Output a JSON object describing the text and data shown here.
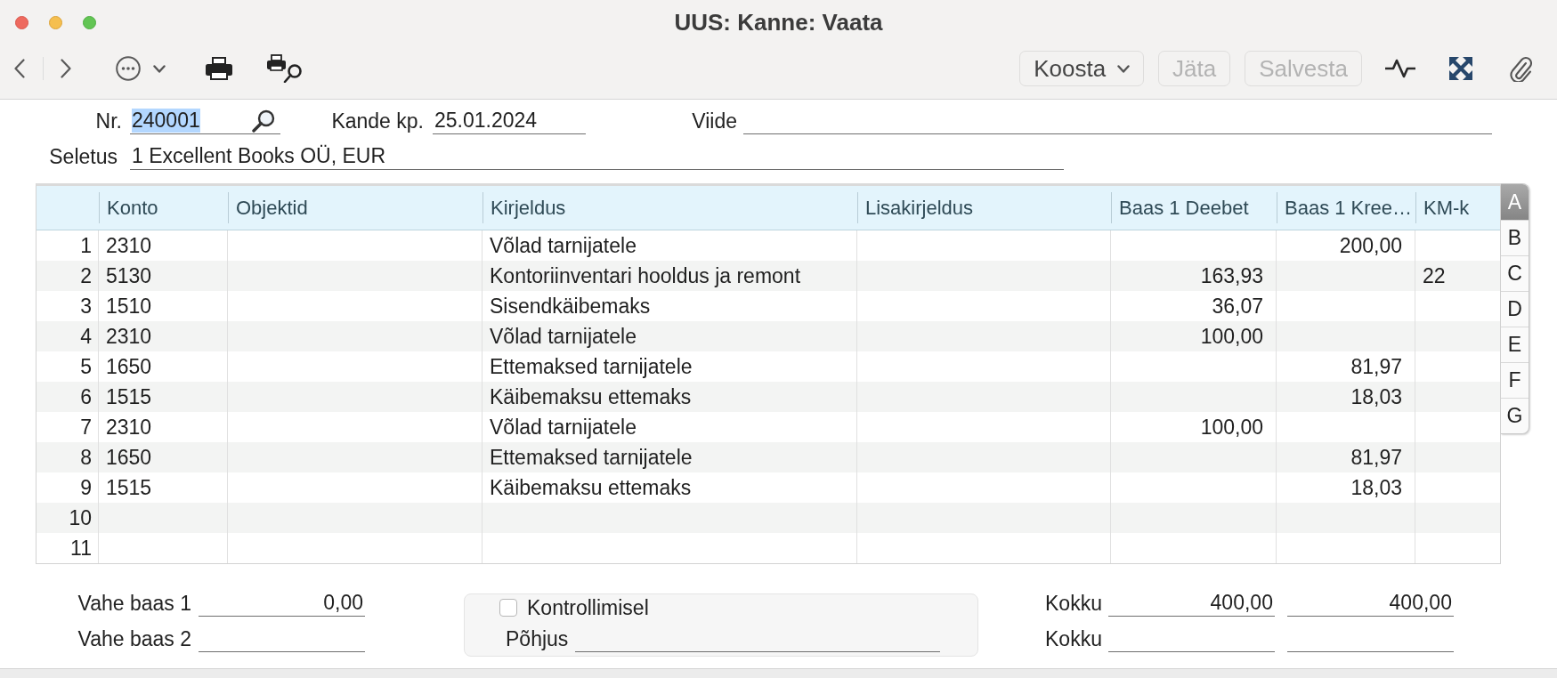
{
  "window": {
    "title": "UUS: Kanne: Vaata"
  },
  "toolbar": {
    "buttons": [
      {
        "label": "Koosta",
        "kind": "menu",
        "disabled": false
      },
      {
        "label": "Jäta",
        "kind": "plain",
        "disabled": true
      },
      {
        "label": "Salvesta",
        "kind": "plain",
        "disabled": true
      }
    ]
  },
  "header": {
    "fields": [
      {
        "label": "Nr.",
        "value": "240001",
        "kind": "lookup",
        "highlighted": true
      },
      {
        "label": "Kande kp.",
        "value": "25.01.2024",
        "kind": "text",
        "highlighted": false
      },
      {
        "label": "Viide",
        "kind": "text"
      },
      {
        "label": "Seletus",
        "value": "1 Excellent Books OÜ, EUR",
        "kind": "text",
        "highlighted": false
      }
    ]
  },
  "table": {
    "columns": [
      {
        "label": "Konto",
        "kind": "text"
      },
      {
        "label": "Objektid",
        "kind": "text"
      },
      {
        "label": "Kirjeldus",
        "kind": "text"
      },
      {
        "label": "Lisakirjeldus",
        "kind": "text"
      },
      {
        "label": "Baas 1 Deebet",
        "kind": "amount"
      },
      {
        "label": "Baas 1 Kree…",
        "kind": "amount"
      },
      {
        "label": "KM-k",
        "kind": "text"
      }
    ],
    "rows": [
      {
        "number": "1",
        "cells": [
          "2310",
          null,
          "Võlad tarnijatele",
          null,
          null,
          "200,00",
          null
        ]
      },
      {
        "number": "2",
        "cells": [
          "5130",
          null,
          "Kontoriinventari hooldus ja remont",
          null,
          "163,93",
          null,
          "22"
        ]
      },
      {
        "number": "3",
        "cells": [
          "1510",
          null,
          "Sisendkäibemaks",
          null,
          "36,07",
          null,
          null
        ]
      },
      {
        "number": "4",
        "cells": [
          "2310",
          null,
          "Võlad tarnijatele",
          null,
          "100,00",
          null,
          null
        ]
      },
      {
        "number": "5",
        "cells": [
          "1650",
          null,
          "Ettemaksed tarnijatele",
          null,
          null,
          "81,97",
          null
        ]
      },
      {
        "number": "6",
        "cells": [
          "1515",
          null,
          "Käibemaksu ettemaks",
          null,
          null,
          "18,03",
          null
        ]
      },
      {
        "number": "7",
        "cells": [
          "2310",
          null,
          "Võlad tarnijatele",
          null,
          "100,00",
          null,
          null
        ]
      },
      {
        "number": "8",
        "cells": [
          "1650",
          null,
          "Ettemaksed tarnijatele",
          null,
          null,
          "81,97",
          null
        ]
      },
      {
        "number": "9",
        "cells": [
          "1515",
          null,
          "Käibemaksu ettemaks",
          null,
          null,
          "18,03",
          null
        ]
      },
      {
        "number": "10",
        "cells": [
          null,
          null,
          null,
          null,
          null,
          null,
          null
        ]
      },
      {
        "number": "11",
        "cells": [
          null,
          null,
          null,
          null,
          null,
          null,
          null
        ]
      }
    ]
  },
  "letter_tabs": [
    {
      "label": "A",
      "selected": true
    },
    {
      "label": "B",
      "selected": false
    },
    {
      "label": "C",
      "selected": false
    },
    {
      "label": "D",
      "selected": false
    },
    {
      "label": "E",
      "selected": false
    },
    {
      "label": "F",
      "selected": false
    },
    {
      "label": "G",
      "selected": false
    }
  ],
  "footer": {
    "differences": [
      {
        "label": "Vahe baas 1",
        "value": "0,00"
      },
      {
        "label": "Vahe baas 2"
      }
    ],
    "review": {
      "checkbox": {
        "label": "Kontrollimisel",
        "checked": false
      },
      "reason": {
        "label": "Põhjus"
      }
    },
    "totals": [
      {
        "label": "Kokku",
        "debit": "400,00",
        "credit": "400,00"
      },
      {
        "label": "Kokku"
      }
    ]
  }
}
